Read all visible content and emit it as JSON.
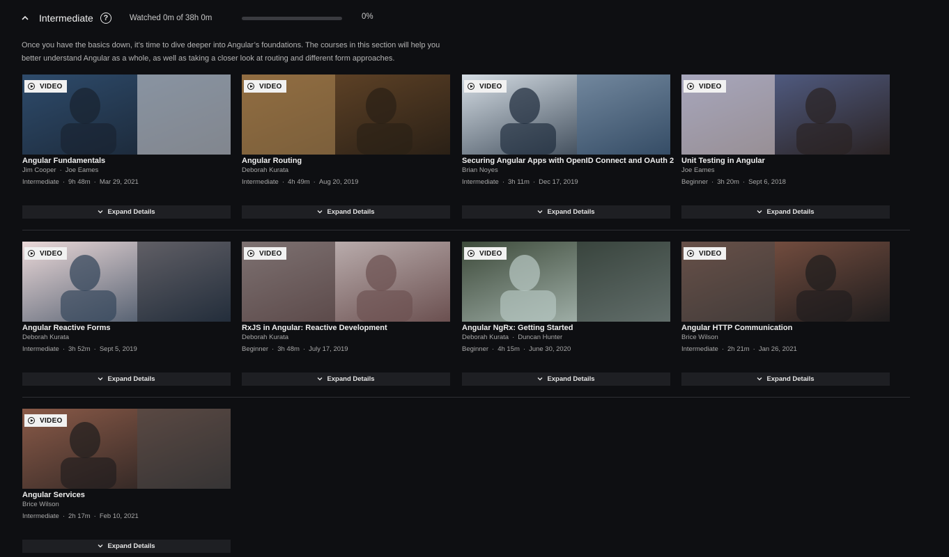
{
  "section": {
    "title": "Intermediate",
    "help_icon": "question-circle-icon",
    "watched": "Watched 0m of 38h 0m",
    "progress_percent": 0,
    "progress_label": "0%",
    "description_line1": "Once you have the basics down, it’s time to dive deeper into Angular’s foundations. The courses in this section will help you",
    "description_line2": "better understand Angular as a whole, as well as taking a closer look at routing and different form approaches."
  },
  "common": {
    "badge": "VIDEO",
    "expand": "Expand Details",
    "dot": "·"
  },
  "courses": [
    {
      "title": "Angular Fundamentals",
      "authors": [
        "Jim Cooper",
        "Joe Eames"
      ],
      "level": "Intermediate",
      "duration": "9h 48m",
      "date": "Mar 29, 2021",
      "theme": [
        "#2e4b6b",
        "#18222f",
        "#d8d9dc"
      ]
    },
    {
      "title": "Angular Routing",
      "authors": [
        "Deborah Kurata"
      ],
      "level": "Intermediate",
      "duration": "4h 49m",
      "date": "Aug 20, 2019",
      "theme": [
        "#6b4a2a",
        "#2a2016",
        "#b08a55"
      ]
    },
    {
      "title": "Securing Angular Apps with OpenID Connect and OAuth 2",
      "authors": [
        "Brian Noyes"
      ],
      "level": "Intermediate",
      "duration": "3h 11m",
      "date": "Dec 17, 2019",
      "theme": [
        "#d5dde4",
        "#1c2a3a",
        "#4a6a8a"
      ]
    },
    {
      "title": "Unit Testing in Angular",
      "authors": [
        "Joe Eames"
      ],
      "level": "Beginner",
      "duration": "3h 20m",
      "date": "Sept 6, 2018",
      "theme": [
        "#5a6a9a",
        "#2a2222",
        "#e8d8d8"
      ]
    },
    {
      "title": "Angular Reactive Forms",
      "authors": [
        "Deborah Kurata"
      ],
      "level": "Intermediate",
      "duration": "3h 52m",
      "date": "Sept 5, 2019",
      "theme": [
        "#ead8d8",
        "#2f4257",
        "#1a1e24"
      ]
    },
    {
      "title": "RxJS in Angular: Reactive Development",
      "authors": [
        "Deborah Kurata"
      ],
      "level": "Beginner",
      "duration": "3h 48m",
      "date": "July 17, 2019",
      "theme": [
        "#cfc6c6",
        "#6b5050",
        "#3a2c2c"
      ]
    },
    {
      "title": "Angular NgRx: Getting Started",
      "authors": [
        "Deborah Kurata",
        "Duncan Hunter"
      ],
      "level": "Beginner",
      "duration": "4h 15m",
      "date": "June 30, 2020",
      "theme": [
        "#3d4a3a",
        "#b9c9c4",
        "#1a2220"
      ]
    },
    {
      "title": "Angular HTTP Communication",
      "authors": [
        "Brice Wilson"
      ],
      "level": "Intermediate",
      "duration": "2h 21m",
      "date": "Jan 26, 2021",
      "theme": [
        "#8a5a48",
        "#1e1c1d",
        "#4a4848"
      ]
    },
    {
      "title": "Angular Services",
      "authors": [
        "Brice Wilson"
      ],
      "level": "Intermediate",
      "duration": "2h 17m",
      "date": "Feb 10, 2021",
      "theme": [
        "#8a5a48",
        "#1e1c1d",
        "#4a4848"
      ]
    }
  ]
}
